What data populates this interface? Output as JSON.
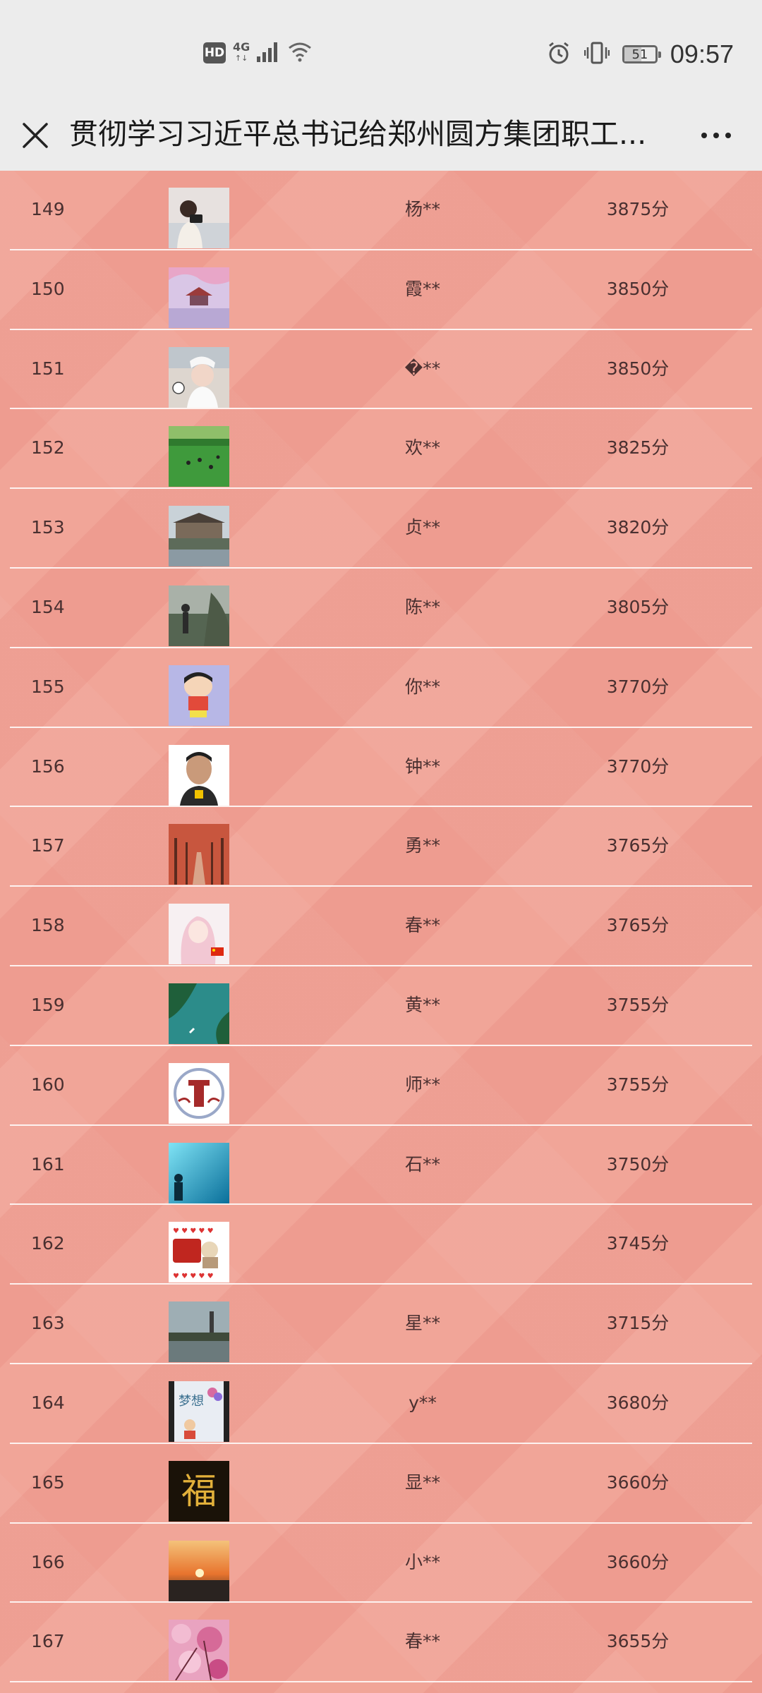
{
  "status_bar": {
    "hd": "HD",
    "network": "4G",
    "network_sub": "↑↓",
    "battery": "51",
    "time": "09:57"
  },
  "title_bar": {
    "title": "贯彻学习习近平总书记给郑州圆方集团职工...",
    "more": "···"
  },
  "leaderboard": {
    "rows": [
      {
        "rank": "149",
        "name": "杨**",
        "score": "3875分",
        "avatar": "portrait-camera"
      },
      {
        "rank": "150",
        "name": "霞**",
        "score": "3850分",
        "avatar": "pavilion-blossom"
      },
      {
        "rank": "151",
        "name": "�**",
        "score": "3850分",
        "avatar": "woman-car-selfie"
      },
      {
        "rank": "152",
        "name": "欢**",
        "score": "3825分",
        "avatar": "green-meadow"
      },
      {
        "rank": "153",
        "name": "贞**",
        "score": "3820分",
        "avatar": "pavilion-lake"
      },
      {
        "rank": "154",
        "name": "陈**",
        "score": "3805分",
        "avatar": "silhouette-haze"
      },
      {
        "rank": "155",
        "name": "你**",
        "score": "3770分",
        "avatar": "cartoon-boy"
      },
      {
        "rank": "156",
        "name": "钟**",
        "score": "3770分",
        "avatar": "man-portrait"
      },
      {
        "rank": "157",
        "name": "勇**",
        "score": "3765分",
        "avatar": "autumn-road"
      },
      {
        "rank": "158",
        "name": "春**",
        "score": "3765分",
        "avatar": "anime-girl-flag"
      },
      {
        "rank": "159",
        "name": "黄**",
        "score": "3755分",
        "avatar": "aerial-river"
      },
      {
        "rank": "160",
        "name": "师**",
        "score": "3755分",
        "avatar": "red-emblem"
      },
      {
        "rank": "161",
        "name": "石**",
        "score": "3750分",
        "avatar": "blue-underwater"
      },
      {
        "rank": "162",
        "name": "",
        "score": "3745分",
        "avatar": "toys-hearts"
      },
      {
        "rank": "163",
        "name": "星**",
        "score": "3715分",
        "avatar": "lake-tower"
      },
      {
        "rank": "164",
        "name": "y**",
        "score": "3680分",
        "avatar": "cartoon-kids-dream"
      },
      {
        "rank": "165",
        "name": "显**",
        "score": "3660分",
        "avatar": "fu-character"
      },
      {
        "rank": "166",
        "name": "小**",
        "score": "3660分",
        "avatar": "sunset-beach"
      },
      {
        "rank": "167",
        "name": "春**",
        "score": "3655分",
        "avatar": "pink-blossoms"
      }
    ]
  }
}
